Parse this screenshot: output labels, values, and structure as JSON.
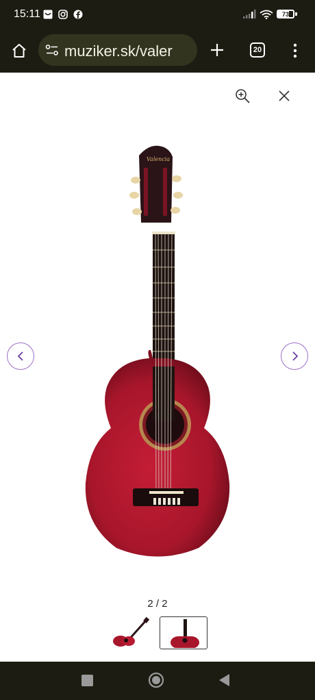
{
  "status_bar": {
    "time": "15:11",
    "battery": "73",
    "icons": [
      "email-notification-icon",
      "instagram-icon",
      "facebook-icon",
      "signal-icon",
      "wifi-icon",
      "battery-icon"
    ]
  },
  "browser": {
    "url": "muziker.sk/valer",
    "tab_count": "20",
    "icons": [
      "home-icon",
      "site-settings-icon",
      "new-tab-icon",
      "tab-switcher-icon",
      "menu-icon"
    ]
  },
  "viewer": {
    "counter": "2 / 2",
    "icons": [
      "zoom-in-icon",
      "close-icon",
      "previous-arrow-icon",
      "next-arrow-icon"
    ],
    "accent_color": "#9b6fc7",
    "guitar_color": "#a8162b"
  },
  "nav_bar": {
    "icons": [
      "recents-icon",
      "home-circle-icon",
      "back-icon"
    ]
  }
}
